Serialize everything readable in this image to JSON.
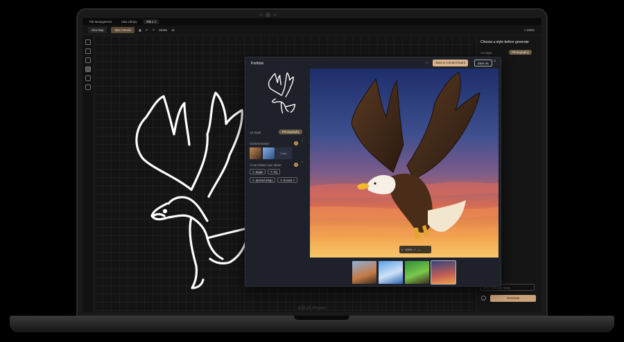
{
  "topbar": {
    "tabs": [
      {
        "label": "File Management"
      },
      {
        "label": "Idea Library"
      },
      {
        "label": "File 1"
      }
    ],
    "close_glyph": "×"
  },
  "toolbar": {
    "modes": [
      "Idea Map",
      "Idea Canvas"
    ],
    "stroke_label": "Stroke",
    "stroke_value": "10",
    "zoom": "100%"
  },
  "right_panel": {
    "title": "Choose a style before generate",
    "art_style_label": "Art Style",
    "art_style_value": "Photography",
    "prompt_placeholder": "Keep input your ideas",
    "generate_label": "Generate"
  },
  "modal": {
    "title": "Portfolio",
    "save_board_label": "Save to Content board",
    "save_as_label": "Save as",
    "close_glyph": "×",
    "art_style_label": "Art Style",
    "art_style_value": "Photography",
    "content_board_label": "Content Board",
    "content_board_badge": "2",
    "color_label": "Color",
    "keywords_label": "AI can Detect your ideas!",
    "keywords_badge": "4",
    "keywords": [
      "Eagle",
      "Fly",
      "Spread wings",
      "Sunset"
    ],
    "zoom_value": "100%"
  },
  "brand": "ASUS ProArt",
  "colors": {
    "accent": "#d7b48c",
    "photography_pill": "#6b5a44",
    "modal_bg": "#1e2129"
  }
}
